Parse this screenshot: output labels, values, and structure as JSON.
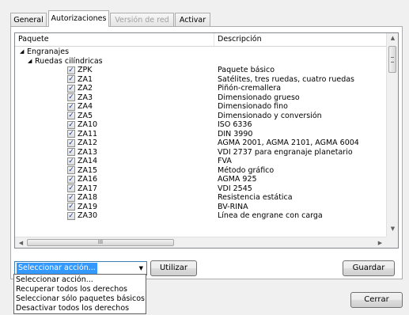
{
  "tabs": [
    {
      "label": "General",
      "state": "normal"
    },
    {
      "label": "Autorizaciones",
      "state": "active"
    },
    {
      "label": "Versión de red",
      "state": "disabled"
    },
    {
      "label": "Activar",
      "state": "normal"
    }
  ],
  "table": {
    "columns": [
      "Paquete",
      "Descripción"
    ],
    "tree": [
      {
        "label": "Engranajes",
        "level": 0,
        "expanded": true
      },
      {
        "label": "Ruedas cilíndricas",
        "level": 1,
        "expanded": true
      }
    ],
    "rows": [
      {
        "code": "ZPK",
        "description": "Paquete básico",
        "checked": true
      },
      {
        "code": "ZA1",
        "description": "Satélites, tres ruedas, cuatro ruedas",
        "checked": true
      },
      {
        "code": "ZA2",
        "description": "Piñón-cremallera",
        "checked": true
      },
      {
        "code": "ZA3",
        "description": "Dimensionado grueso",
        "checked": true
      },
      {
        "code": "ZA4",
        "description": "Dimensionado fino",
        "checked": true
      },
      {
        "code": "ZA5",
        "description": "Dimensionado y conversión",
        "checked": true
      },
      {
        "code": "ZA10",
        "description": "ISO 6336",
        "checked": true
      },
      {
        "code": "ZA11",
        "description": "DIN 3990",
        "checked": true
      },
      {
        "code": "ZA12",
        "description": "AGMA 2001, AGMA 2101, AGMA 6004",
        "checked": true
      },
      {
        "code": "ZA13",
        "description": "VDI 2737 para engranaje planetario",
        "checked": true
      },
      {
        "code": "ZA14",
        "description": "FVA",
        "checked": true
      },
      {
        "code": "ZA15",
        "description": "Método gráfico",
        "checked": true
      },
      {
        "code": "ZA16",
        "description": "AGMA 925",
        "checked": true
      },
      {
        "code": "ZA17",
        "description": "VDI 2545",
        "checked": true
      },
      {
        "code": "ZA18",
        "description": "Resistencia estática",
        "checked": true
      },
      {
        "code": "ZA19",
        "description": "BV-RINA",
        "checked": true
      },
      {
        "code": "ZA30",
        "description": "Línea de engrane con carga",
        "checked": true
      }
    ]
  },
  "action_select": {
    "value": "Seleccionar acción...",
    "options": [
      "Seleccionar acción...",
      "Recuperar todos los derechos",
      "Seleccionar sólo paquetes básicos",
      "Desactivar todos los derechos"
    ]
  },
  "buttons": {
    "apply": "Utilizar",
    "save": "Guardar",
    "close": "Cerrar"
  },
  "scroll": {
    "h_thumb_grip": "III"
  }
}
